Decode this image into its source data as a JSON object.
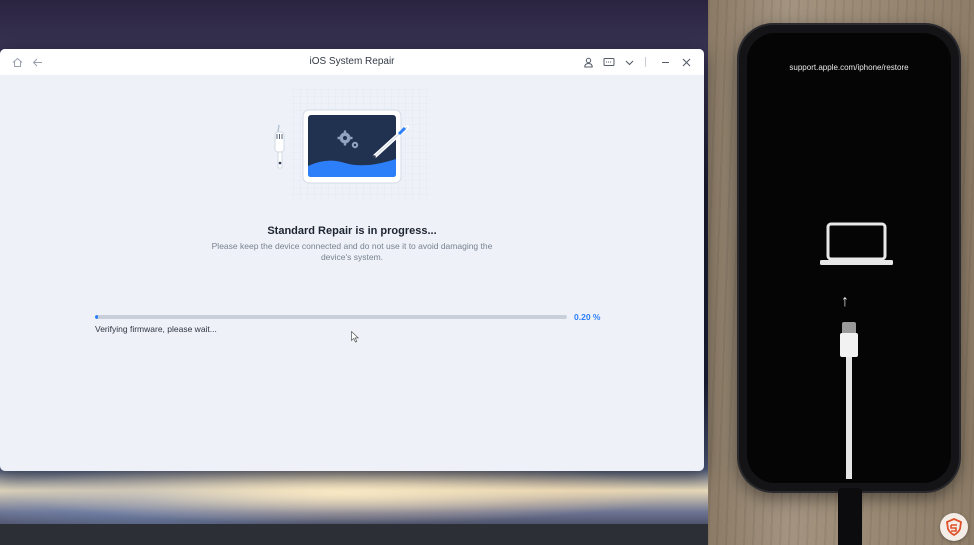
{
  "app": {
    "title": "iOS System Repair",
    "heading": "Standard Repair is in progress...",
    "subtext": "Please keep the device connected and do not use it to avoid damaging the device's system.",
    "progress": {
      "percent_text": "0.20 %",
      "value": 0.002,
      "status": "Verifying firmware, please wait..."
    },
    "titlebar_icons": {
      "home": "home-icon",
      "back": "back-arrow-icon",
      "account": "user-icon",
      "feedback": "message-icon",
      "menu": "chevron-down-icon",
      "minimize": "minimize-icon",
      "close": "close-icon"
    },
    "accent_color": "#2d7ff9"
  },
  "phone": {
    "url_text": "support.apple.com/iphone/restore",
    "screen_icon": "laptop-icon",
    "arrow_icon": "up-arrow-icon",
    "cable_icon": "lightning-cable-icon"
  }
}
